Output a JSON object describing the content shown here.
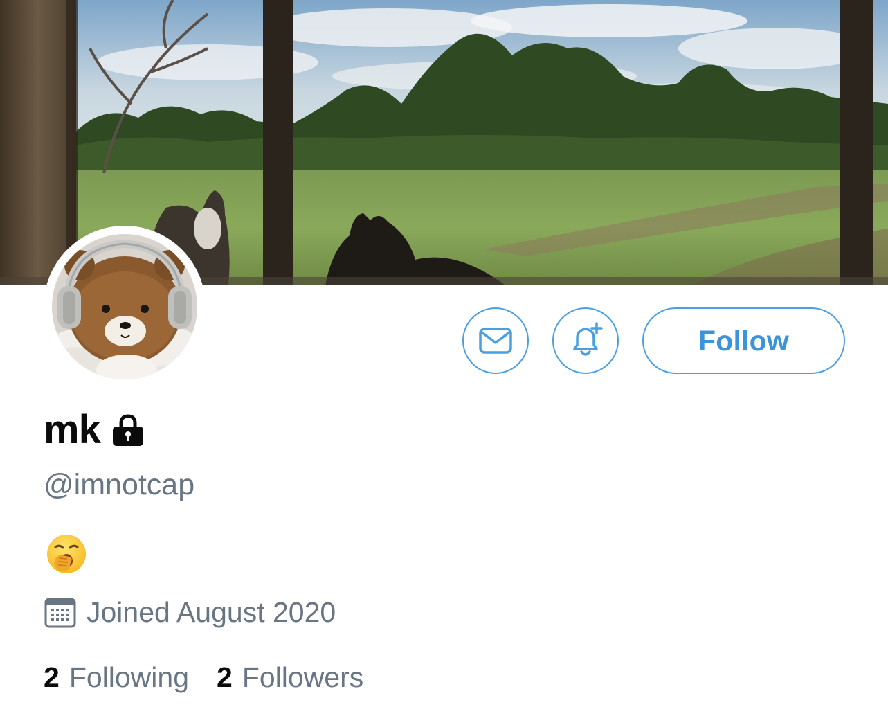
{
  "profile": {
    "display_name": "mk",
    "handle": "@imnotcap",
    "bio_emoji": "yawning-face",
    "joined": "Joined August 2020",
    "protected": true
  },
  "actions": {
    "follow_label": "Follow",
    "message_icon": "envelope-icon",
    "notify_icon": "bell-plus-icon"
  },
  "stats": {
    "following_count": "2",
    "following_label": "Following",
    "followers_count": "2",
    "followers_label": "Followers"
  },
  "colors": {
    "accent": "#4a9fe0",
    "accent_text": "#3b94d9",
    "secondary_text": "#687683",
    "primary_text": "#0b0b0b"
  }
}
